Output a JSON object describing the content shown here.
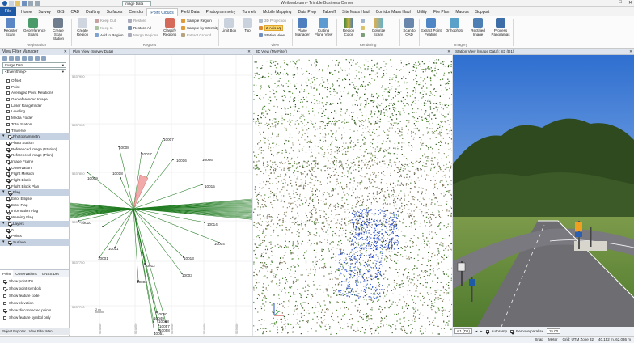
{
  "window": {
    "title": "Weilsenbrunn - Trimble Business Center",
    "combo_value": "Image Data",
    "controls": [
      "–",
      "□",
      "✕"
    ]
  },
  "tabs": [
    "File",
    "Home",
    "Survey",
    "GIS",
    "CAD",
    "Drafting",
    "Surfaces",
    "Corridor",
    "Point Clouds",
    "Field Data",
    "Photogrammetry",
    "Tunnels",
    "Mobile Mapping",
    "Data Prep",
    "Takeoff",
    "Site Mass Haul",
    "Corridor Mass Haul",
    "Utility",
    "File Plan",
    "Macros",
    "Support"
  ],
  "ribbon": {
    "register_scans": "Register Scans",
    "georeference_scans": "Georeference Scans",
    "create_scan_station": "Create Scan Station",
    "group_registration": "Registration",
    "create_region": "Create Region",
    "keep_out": "Keep Out",
    "keep_in": "Keep In",
    "add_to_region": "Add to Region",
    "restore": "Restore",
    "restore_all": "Restore All",
    "merge_regions": "Merge Regions",
    "classify_regions": "Classify Regions",
    "sample_region": "Sample Region",
    "sample_by_intensity": "Sample by Intensity",
    "extract_ground": "Extract Ground",
    "group_regions": "Regions",
    "limit_box": "Limit Box",
    "top": "Top",
    "projection_3d": "3D Projection",
    "axis_up": "Z Axis Up",
    "station_view": "Station View",
    "group_view": "View",
    "plane_manager": "Plane Manager",
    "cutting_plane_view": "Cutting Plane View",
    "region_color": "Region Color",
    "colorize_scans": "Colorize Scans",
    "group_rendering": "Rendering",
    "scan_to_cad": "Scan to CAD",
    "extract_point_feature": "Extract Point Feature",
    "orthophoto": "Orthophoto",
    "rectified_image": "Rectified Image",
    "process_panoramas": "Process Panoramas",
    "group_imagery": "Imagery"
  },
  "left_panel": {
    "title": "View Filter Manager",
    "combo_top": "Image Data",
    "combo_filter": "<Everything>",
    "items": [
      {
        "label": "Offset",
        "checked": false,
        "group": false
      },
      {
        "label": "Point",
        "checked": false,
        "group": false
      },
      {
        "label": "Averaged Point Relations",
        "checked": false,
        "group": false
      },
      {
        "label": "Georeferenced Image",
        "checked": false,
        "group": false
      },
      {
        "label": "Laser Rangefinder",
        "checked": false,
        "group": false
      },
      {
        "label": "Leveling",
        "checked": false,
        "group": false
      },
      {
        "label": "Media Folder",
        "checked": false,
        "group": false
      },
      {
        "label": "Total Station",
        "checked": false,
        "group": false
      },
      {
        "label": "Traverse",
        "checked": false,
        "group": false
      },
      {
        "label": "Photogrammetry",
        "checked": true,
        "group": true
      },
      {
        "label": "Photo Station",
        "checked": true,
        "group": false
      },
      {
        "label": "Referenced Image (Station)",
        "checked": true,
        "group": false
      },
      {
        "label": "Referenced Image (Plan)",
        "checked": true,
        "group": false
      },
      {
        "label": "Image Frame",
        "checked": true,
        "group": false
      },
      {
        "label": "Observation",
        "checked": true,
        "group": false
      },
      {
        "label": "Flight Mission",
        "checked": true,
        "group": false
      },
      {
        "label": "Flight Block",
        "checked": true,
        "group": false
      },
      {
        "label": "Flight Block Plan",
        "checked": true,
        "group": false
      },
      {
        "label": "Flag",
        "checked": true,
        "group": true
      },
      {
        "label": "Error Ellipse",
        "checked": true,
        "group": false
      },
      {
        "label": "Error Flag",
        "checked": true,
        "group": false
      },
      {
        "label": "Information Flag",
        "checked": true,
        "group": false
      },
      {
        "label": "Warning Flag",
        "checked": true,
        "group": false
      },
      {
        "label": "Layers",
        "checked": true,
        "group": true
      },
      {
        "label": "0",
        "checked": true,
        "group": false
      },
      {
        "label": "Points",
        "checked": true,
        "group": false
      },
      {
        "label": "Surface",
        "checked": true,
        "group": true
      }
    ],
    "bottom_tabs": [
      "Point",
      "Observations",
      "GNSS Det"
    ],
    "options": [
      {
        "label": "Show point IDs",
        "checked": true
      },
      {
        "label": "Show point symbols",
        "checked": true
      },
      {
        "label": "Show feature code",
        "checked": false
      },
      {
        "label": "Show elevation",
        "checked": false
      },
      {
        "label": "Show disconnected points",
        "checked": true
      },
      {
        "label": "Show feature symbol only",
        "checked": false
      }
    ],
    "footer_tabs": [
      "Project Explorer",
      "View Filter Man..."
    ]
  },
  "plan_view": {
    "title": "Plan View (Survey Data)",
    "y_ticks": [
      "5537950",
      "5537900",
      "5537850",
      "5537800",
      "5537750",
      "5537700"
    ],
    "x_ticks": [
      "524800",
      "524850",
      "524900",
      "524950",
      "525000"
    ],
    "scale": "2 m",
    "labels": [
      {
        "id": "10007"
      },
      {
        "id": "10008"
      },
      {
        "id": "10017"
      },
      {
        "id": "10018"
      },
      {
        "id": "10016"
      },
      {
        "id": "10006"
      },
      {
        "id": "10009"
      },
      {
        "id": "10015"
      },
      {
        "id": "10010"
      },
      {
        "id": "10014"
      },
      {
        "id": "10004"
      },
      {
        "id": "10011"
      },
      {
        "id": "10001"
      },
      {
        "id": "10013"
      },
      {
        "id": "10012"
      },
      {
        "id": "10003"
      },
      {
        "id": "10002"
      },
      {
        "id": "10050"
      },
      {
        "id": "10049"
      },
      {
        "id": "10048"
      },
      {
        "id": "10057"
      },
      {
        "id": "10058"
      },
      {
        "id": "10051"
      }
    ]
  },
  "view3d": {
    "title": "3D View (My Filter)"
  },
  "station_view": {
    "title": "Station View (Image Data): st1 (D1)",
    "station_combo": "st1 (D1)",
    "autoramp": "Autoramp",
    "remove_parallax": "Remove parallax",
    "parallax_value": "15.00"
  },
  "statusbar": {
    "snap": "Snap",
    "units": "Meter",
    "grid": "Grid: UTM Zone 32",
    "coords": "40.152 m, 62.036 m"
  },
  "colors": {
    "accent": "#1f5aa6",
    "panel_header": "#dde4ee",
    "group_row": "#c6d2e2",
    "highlight": "#f9d36a"
  }
}
